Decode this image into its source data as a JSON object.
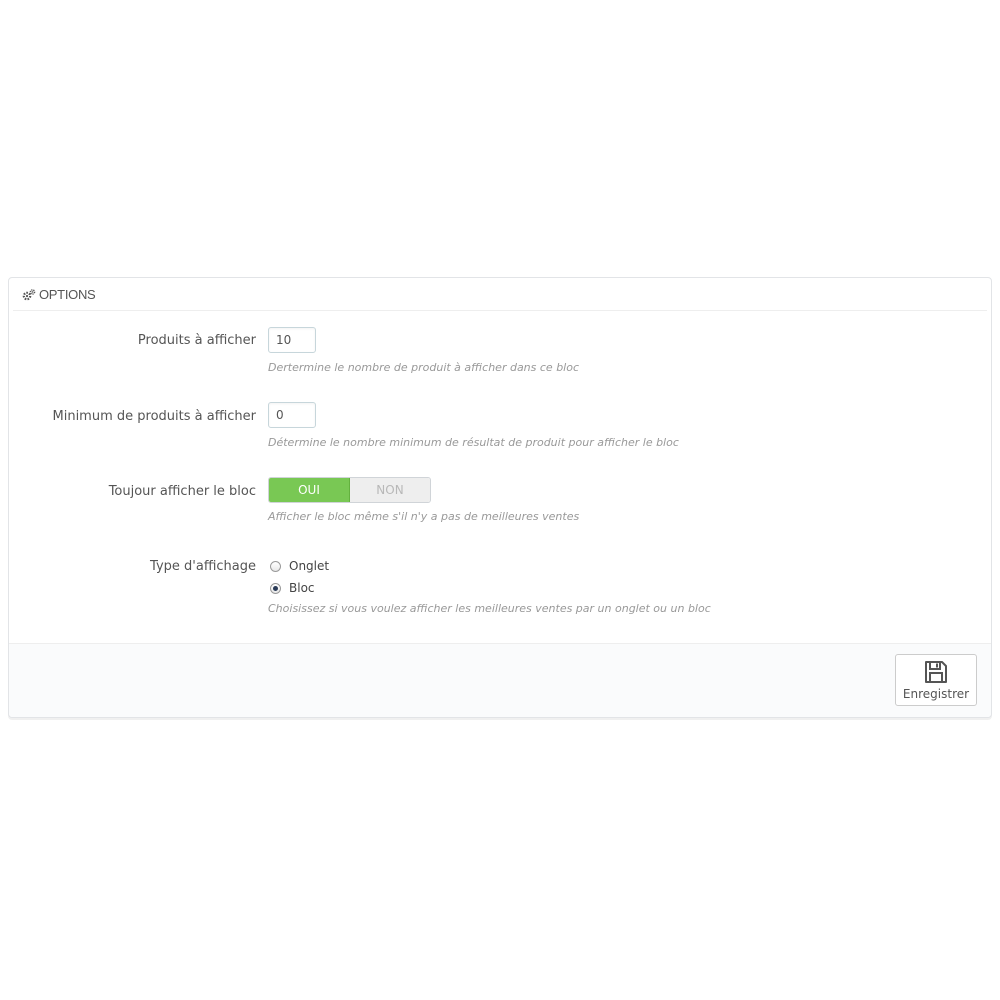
{
  "panel": {
    "title": "OPTIONS",
    "icon": "cogs-icon"
  },
  "fields": {
    "products_to_show": {
      "label": "Produits à afficher",
      "value": "10",
      "help": "Dertermine le nombre de produit à afficher dans ce bloc"
    },
    "min_products": {
      "label": "Minimum de produits à afficher",
      "value": "0",
      "help": "Détermine le nombre minimum de résultat de produit pour afficher le bloc"
    },
    "always_show": {
      "label": "Toujour afficher le bloc",
      "on_label": "OUI",
      "off_label": "NON",
      "selected": "OUI",
      "help": "Afficher le bloc même s'il n'y a pas de meilleures ventes"
    },
    "display_type": {
      "label": "Type d'affichage",
      "options": [
        "Onglet",
        "Bloc"
      ],
      "selected": "Bloc",
      "help": "Choisissez si vous voulez afficher les meilleures ventes par un onglet ou un bloc"
    }
  },
  "footer": {
    "save_label": "Enregistrer",
    "save_icon": "floppy-disk-icon"
  },
  "colors": {
    "switch_on": "#79c854",
    "switch_off": "#eeeeee"
  }
}
